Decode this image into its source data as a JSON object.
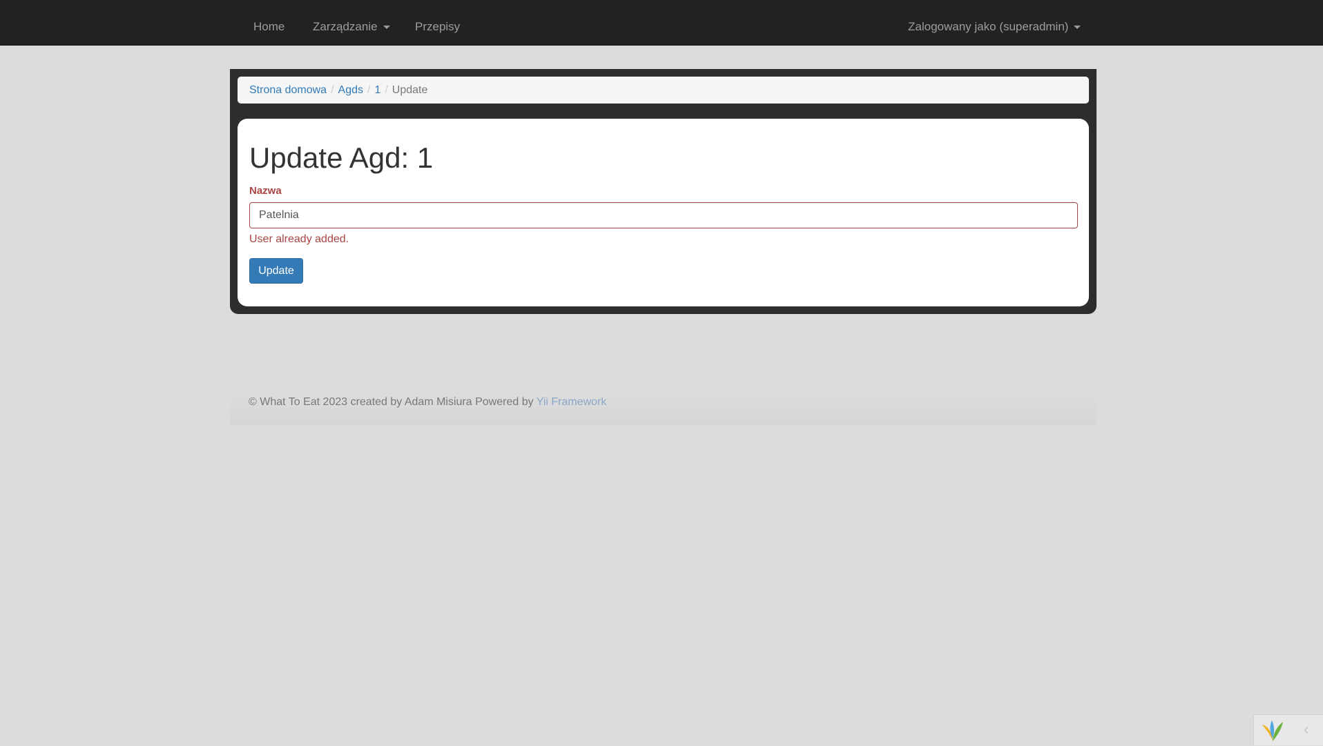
{
  "navbar": {
    "items": [
      {
        "label": "Home"
      },
      {
        "label": "Zarządzanie"
      },
      {
        "label": "Przepisy"
      }
    ],
    "user_menu": "Zalogowany jako (superadmin)"
  },
  "breadcrumb": {
    "items": [
      "Strona domowa",
      "Agds",
      "1"
    ],
    "active": "Update",
    "separator": "/"
  },
  "page": {
    "title": "Update Agd: 1",
    "field": {
      "label": "Nazwa",
      "value": "Patelnia",
      "error": "User already added."
    },
    "submit_label": "Update"
  },
  "footer": {
    "text": "© What To Eat 2023 created by Adam Misiura Powered by ",
    "link": "Yii Framework"
  },
  "debug_toolbar": {
    "logo_icon": "yii-logo-icon",
    "toggle_icon": "chevron-left-icon"
  }
}
